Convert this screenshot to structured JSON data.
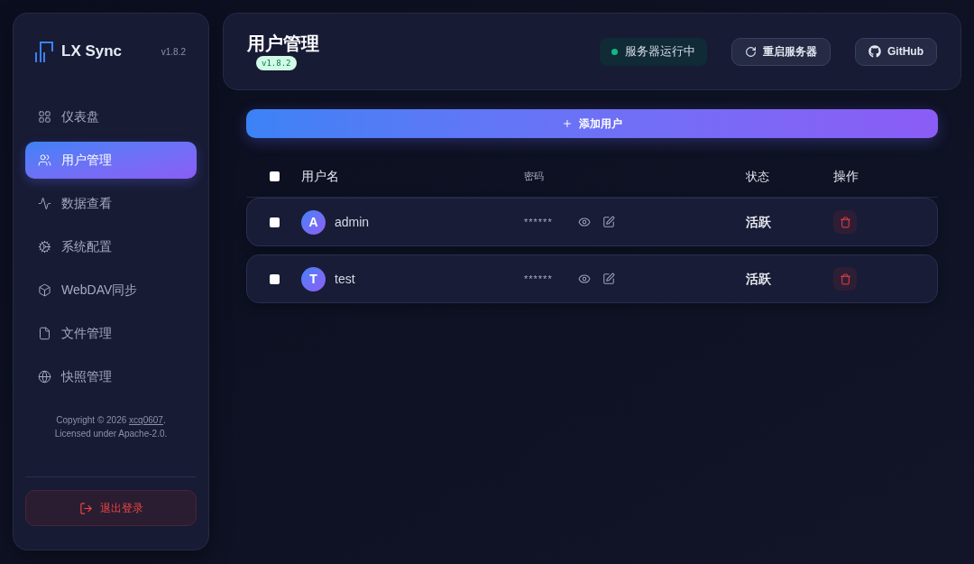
{
  "sidebar": {
    "app_name": "LX Sync",
    "version": "v1.8.2",
    "nav_items": [
      {
        "label": "仪表盘",
        "selected": false
      },
      {
        "label": "用户管理",
        "selected": true
      },
      {
        "label": "数据查看",
        "selected": false
      },
      {
        "label": "系统配置",
        "selected": false
      },
      {
        "label": "WebDAV同步",
        "selected": false
      },
      {
        "label": "文件管理",
        "selected": false
      },
      {
        "label": "快照管理",
        "selected": false
      }
    ],
    "footer": {
      "copyright_prefix": "Copyright © 2026 ",
      "author_link": "xcq0607",
      "copyright_suffix": ".",
      "license": "Licensed under Apache-2.0."
    },
    "logout_button": {
      "label": "退出登录"
    }
  },
  "header": {
    "title": "用户管理",
    "version_badge": "v1.8.2",
    "server_status": {
      "label": "服务器运行中",
      "running": true
    },
    "buttons": [
      {
        "label": "重启服务器"
      },
      {
        "label": "GitHub"
      }
    ]
  },
  "add_user_button": {
    "label": "添加用户"
  },
  "table": {
    "select_all": {
      "checked": false
    },
    "columns": [
      "用户名",
      "密码",
      "状态",
      "操作"
    ],
    "rows": [
      {
        "checked": false,
        "avatar_letter": "A",
        "username": "admin",
        "password": "******",
        "status": "活跃"
      },
      {
        "checked": false,
        "avatar_letter": "T",
        "username": "test",
        "password": "******",
        "status": "活跃"
      }
    ]
  }
}
